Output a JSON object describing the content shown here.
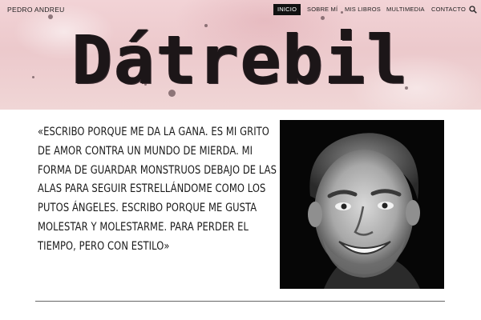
{
  "header": {
    "site_name": "PEDRO ANDREU",
    "nav": [
      {
        "label": "INICIO",
        "active": true
      },
      {
        "label": "SOBRE MÍ",
        "active": false
      },
      {
        "label": "MIS LIBROS",
        "active": false
      },
      {
        "label": "MULTIMEDIA",
        "active": false
      },
      {
        "label": "CONTACTO",
        "active": false
      }
    ],
    "search_icon": "search-icon"
  },
  "hero": {
    "logo_text": "Dátrebil"
  },
  "main": {
    "quote": "«ESCRIBO PORQUE ME DA LA GANA. ES MI GRITO DE AMOR CONTRA UN MUNDO DE MIERDA. MI FORMA DE GUARDAR MONSTRUOS DEBAJO DE LAS ALAS PARA SEGUIR ESTRELLÁNDOME COMO LOS PUTOS ÁNGELES. ESCRIBO PORQUE ME GUSTA MOLESTAR Y MOLESTARME. PARA PERDER EL TIEMPO, PERO CON ESTILO»",
    "photo_icon": "author-portrait"
  },
  "colors": {
    "banner": "#ecc9cc",
    "text": "#1a1a1a",
    "nav_active_bg": "#111111"
  }
}
